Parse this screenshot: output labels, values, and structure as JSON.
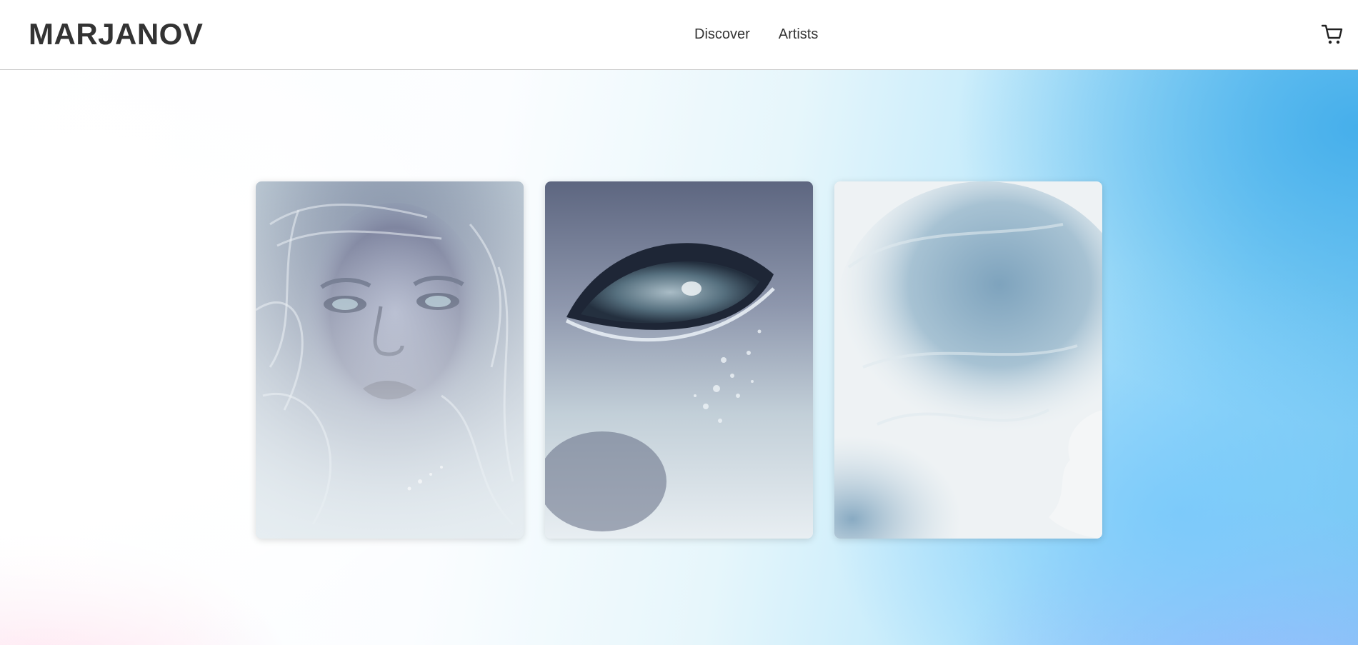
{
  "brand": {
    "name": "MARJANOV"
  },
  "nav": {
    "items": [
      {
        "label": "Discover"
      },
      {
        "label": "Artists"
      }
    ]
  },
  "header": {
    "cart_icon": "shopping-cart-icon"
  },
  "gallery": {
    "cards": [
      {
        "subject": "face-portrait-artwork"
      },
      {
        "subject": "eye-closeup-artwork"
      },
      {
        "subject": "smoke-profile-artwork"
      }
    ]
  },
  "colors": {
    "text": "#333333",
    "accent_blue": "#46afeb",
    "header_bg": "#ffffff"
  }
}
